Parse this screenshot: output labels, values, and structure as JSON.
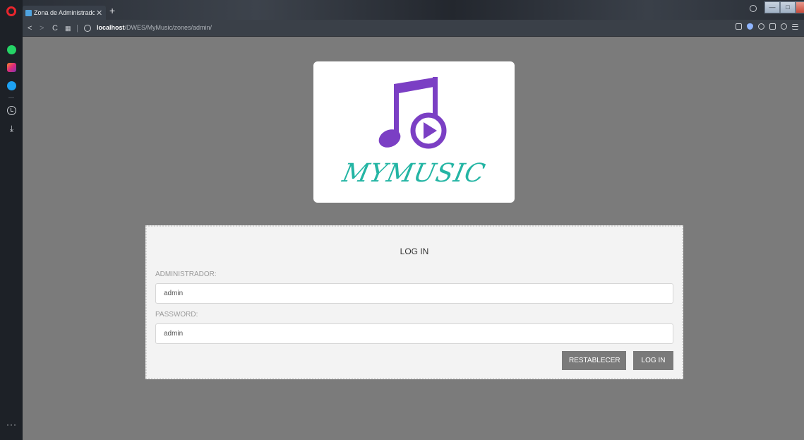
{
  "browser": {
    "tab_title": "Zona de Administrador",
    "tab_close": "✕",
    "new_tab": "+",
    "url_host": "localhost",
    "url_path": "/DWES/MyMusic/zones/admin/"
  },
  "logo": {
    "text": "MYMUSIC",
    "colors": {
      "note": "#7b3fc4",
      "text": "#24b5a4"
    }
  },
  "login": {
    "title": "LOG IN",
    "user_label": "ADMINISTRADOR:",
    "user_value": "admin",
    "pass_label": "PASSWORD:",
    "pass_value": "admin",
    "reset_label": "RESTABLECER",
    "submit_label": "LOG IN"
  }
}
